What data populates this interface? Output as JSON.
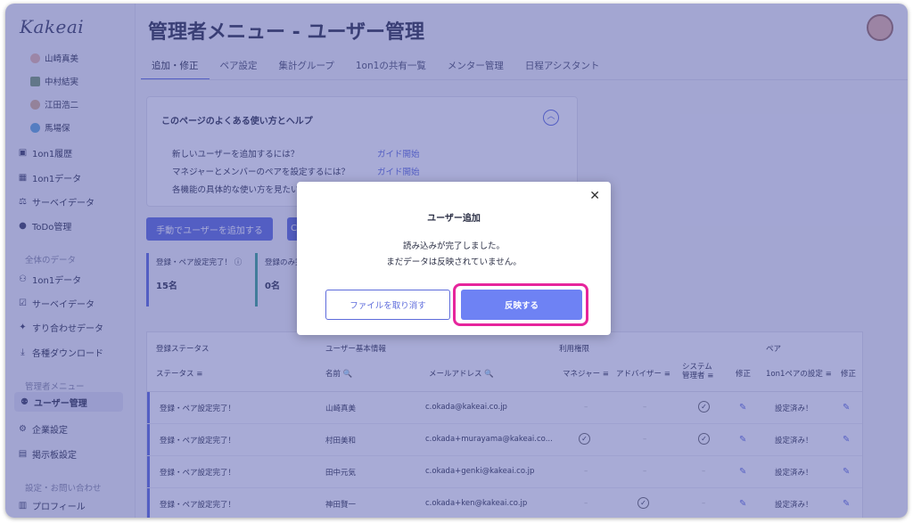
{
  "app": {
    "logo": "Kakeai",
    "page_title": "管理者メニュー - ユーザー管理"
  },
  "sidebar": {
    "members": [
      "山崎真美",
      "中村結実",
      "江田浩二",
      "馬場保"
    ],
    "personal": [
      "1on1履歴",
      "1on1データ",
      "サーベイデータ",
      "ToDo管理"
    ],
    "all_data_heading": "全体のデータ",
    "all_data": [
      "1on1データ",
      "サーベイデータ",
      "すり合わせデータ",
      "各種ダウンロード"
    ],
    "admin_heading": "管理者メニュー",
    "admin": [
      "ユーザー管理",
      "企業設定",
      "掲示板設定"
    ],
    "settings_heading": "設定・お問い合わせ",
    "settings": [
      "プロフィール"
    ]
  },
  "tabs": [
    "追加・修正",
    "ペア設定",
    "集計グループ",
    "1on1の共有一覧",
    "メンター管理",
    "日程アシスタント"
  ],
  "help": {
    "title": "このページのよくある使い方とヘルプ",
    "questions": [
      {
        "q": "新しいユーザーを追加するには？",
        "link": "ガイド開始"
      },
      {
        "q": "マネジャーとメンバーのペアを設定するには？",
        "link": "ガイド開始"
      },
      {
        "q": "各機能の具体的な使い方を見たい"
      }
    ]
  },
  "actions": {
    "manual_add": "手動でユーザーを追加する",
    "other_initial": "C"
  },
  "stats": [
    {
      "label": "登録・ペア設定完了！ ⓘ",
      "value": "15名"
    },
    {
      "label": "登録のみ完",
      "value": "0名"
    }
  ],
  "table": {
    "groups": {
      "status": "登録ステータス",
      "basic": "ユーザー基本情報",
      "perm": "利用権限",
      "pair": "ペア"
    },
    "headers": {
      "status": "ステータス ≡",
      "name": "名前 🔍",
      "email": "メールアドレス 🔍",
      "manager": "マネジャー ≡",
      "advisor": "アドバイザー ≡",
      "sysadmin": "システム\n管理者 ≡",
      "edit": "修正",
      "pair": "1on1ペアの設定 ≡",
      "pair_edit": "修正"
    },
    "rows": [
      {
        "status": "登録・ペア設定完了！",
        "name": "山崎真美",
        "email": "c.okada@kakeai.co.jp",
        "manager": "–",
        "advisor": "–",
        "sysadmin": "✓",
        "pair": "設定済み！"
      },
      {
        "status": "登録・ペア設定完了！",
        "name": "村田美和",
        "email": "c.okada+murayama@kakeai.co...",
        "manager": "✓",
        "advisor": "–",
        "sysadmin": "✓",
        "pair": "設定済み！"
      },
      {
        "status": "登録・ペア設定完了！",
        "name": "田中元気",
        "email": "c.okada+genki@kakeai.co.jp",
        "manager": "–",
        "advisor": "–",
        "sysadmin": "–",
        "pair": "設定済み！"
      },
      {
        "status": "登録・ペア設定完了！",
        "name": "神田賢一",
        "email": "c.okada+ken@kakeai.co.jp",
        "manager": "–",
        "advisor": "✓",
        "sysadmin": "–",
        "pair": "設定済み！"
      }
    ]
  },
  "modal": {
    "title": "ユーザー追加",
    "line1": "読み込みが完了しました。",
    "line2": "まだデータは反映されていません。",
    "cancel_label": "ファイルを取り消す",
    "apply_label": "反映する",
    "close_glyph": "✕"
  },
  "colors": {
    "accent": "#5d6bdb",
    "overlay": "#4a50aa",
    "highlight": "#e6259c",
    "apply": "#6e82f4"
  }
}
